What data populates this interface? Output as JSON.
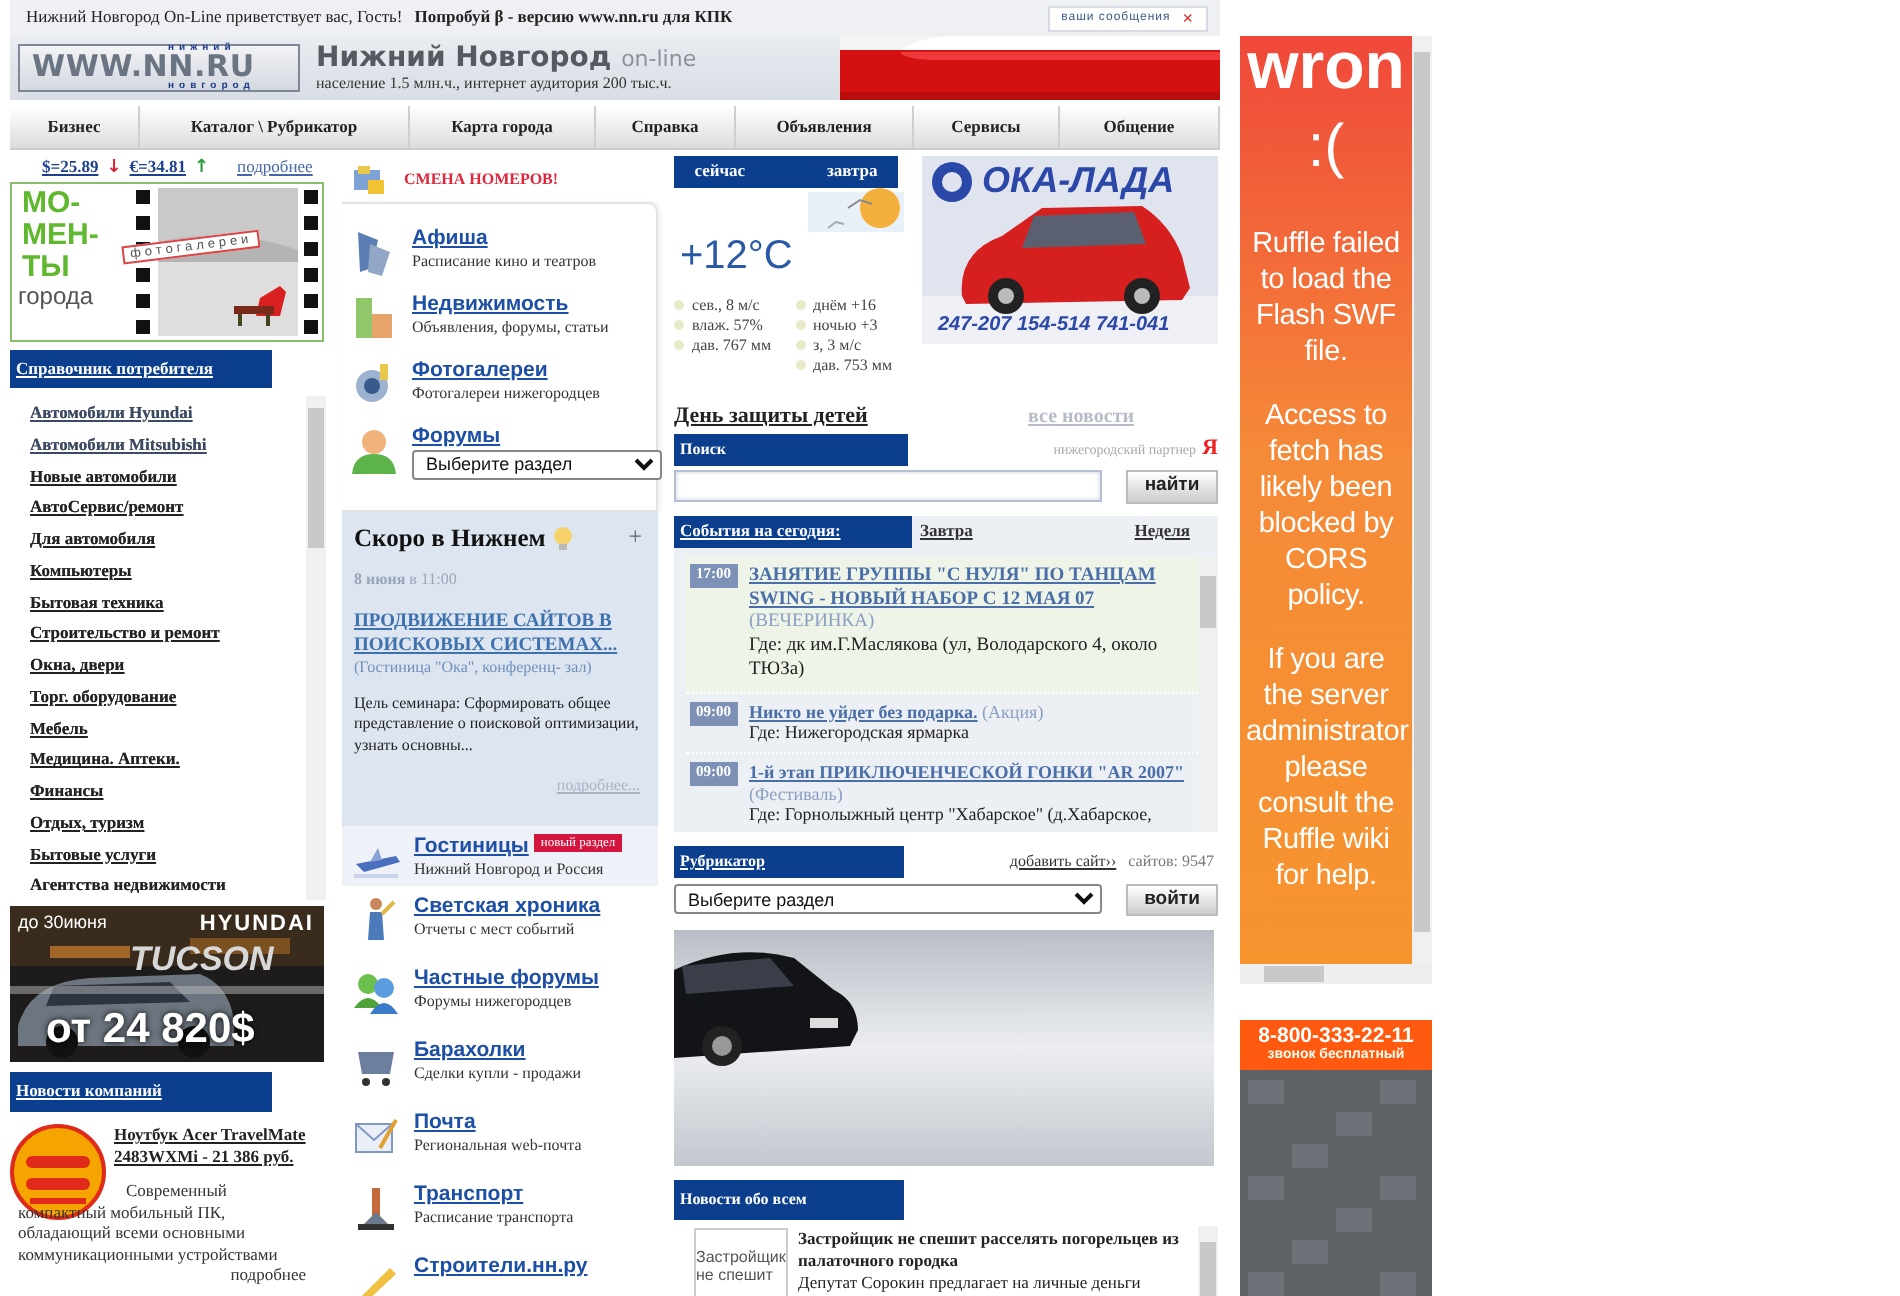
{
  "top_bar": {
    "greeting": "Нижний Новгород On-Line приветствует вас, Гость!",
    "promo": "Попробуй β - версию www.nn.ru для КПК",
    "messages_button": "ваши сообщения",
    "close_button": "×"
  },
  "logo": {
    "main": "WWW.NN.RU",
    "top": "нижний",
    "bottom": "новгород"
  },
  "site": {
    "title": "Нижний Новгород",
    "suffix": "on-line",
    "tagline": "население 1.5 млн.ч., интернет аудитория 200 тыс.ч."
  },
  "nav": [
    "Бизнес",
    "Каталог \\ Рубрикатор",
    "Карта города",
    "Справка",
    "Объявления",
    "Сервисы",
    "Общение"
  ],
  "currency": {
    "rates": [
      {
        "text": "$=25.89",
        "arrow": "↓",
        "kind": "down"
      },
      {
        "text": "€=34.81",
        "arrow": "↑",
        "kind": "up"
      }
    ],
    "more": "подробнее"
  },
  "photo_banner": {
    "title_lines": [
      "МО-",
      "МЕН-",
      "ТЫ"
    ],
    "subtitle": "города",
    "tag": "фотогалереи"
  },
  "consumer_guide": {
    "title": "Справочник потребителя",
    "items": [
      {
        "label": "Автомобили Hyundai",
        "kind": "sponsored"
      },
      {
        "label": "Автомобили Mitsubishi",
        "kind": "sponsored"
      },
      {
        "label": "Новые автомобили",
        "kind": "link"
      },
      {
        "label": "АвтоСервис/ремонт",
        "kind": "link"
      },
      {
        "label": "Для автомобиля",
        "kind": "link"
      },
      {
        "label": "Компьютеры",
        "kind": "link"
      },
      {
        "label": "Бытовая техника",
        "kind": "link"
      },
      {
        "label": "Строительство и ремонт",
        "kind": "link"
      },
      {
        "label": "Окна, двери",
        "kind": "link"
      },
      {
        "label": "Торг. оборудование",
        "kind": "link"
      },
      {
        "label": "Мебель",
        "kind": "link"
      },
      {
        "label": "Медицина. Аптеки.",
        "kind": "link"
      },
      {
        "label": "Финансы",
        "kind": "link"
      },
      {
        "label": "Отдых, туризм",
        "kind": "link"
      },
      {
        "label": "Бытовые услуги",
        "kind": "link"
      },
      {
        "label": "Агентства недвижимости",
        "kind": "plain"
      }
    ]
  },
  "car_ad": {
    "promo": "до 30июня",
    "brand": "HYUNDAI",
    "model": "TUCSON",
    "price": "от 24 820$"
  },
  "company_news": {
    "title": "Новости компаний",
    "items": [
      {
        "title": "Ноутбук Acer TravelMate 2483WXMi - 21 386 руб.",
        "text": "Современный компактный мобильный ПК, обладающий всеми основными коммуникационными устройствами",
        "more": "подробнее"
      }
    ]
  },
  "notice": "СМЕНА НОМЕРОВ!",
  "services": [
    {
      "title": "Афиша",
      "subtitle": "Расписание кино и театров"
    },
    {
      "title": "Недвижимость",
      "subtitle": "Объявления, форумы, статьи"
    },
    {
      "title": "Фотогалереи",
      "subtitle": "Фотогалереи нижегородцев"
    },
    {
      "title": "Форумы",
      "select": "Выберите раздел"
    }
  ],
  "soon": {
    "title": "Скоро в Нижнем",
    "plus": "+",
    "date": "8 июня",
    "time": "в 11:00",
    "headline": "ПРОДВИЖЕНИЕ САЙТОВ В ПОИСКОВЫХ СИСТЕМАХ...",
    "place": "(Гостиница \"Ока\", конференц- зал)",
    "text": "Цель семинара: Сформировать общее представление о поисковой оптимизации, узнать основны...",
    "more": "подробнее..."
  },
  "services_more": [
    {
      "title": "Гостиницы",
      "subtitle": "Нижний Новгород и Россия",
      "badge": "новый раздел",
      "highlighted": true
    },
    {
      "title": "Светская хроника",
      "subtitle": "Отчеты с мест событий",
      "highlighted": false
    },
    {
      "title": "Частные форумы",
      "subtitle": "Форумы нижегородцев",
      "highlighted": false
    },
    {
      "title": "Барахолки",
      "subtitle": "Сделки купли - продажи",
      "highlighted": false
    },
    {
      "title": "Почта",
      "subtitle": "Региональная web-почта",
      "highlighted": false
    },
    {
      "title": "Транспорт",
      "subtitle": "Расписание транспорта",
      "highlighted": false
    },
    {
      "title": "Строители.нн.ру",
      "highlighted": false
    }
  ],
  "weather": {
    "tabs": [
      "сейчас",
      "завтра"
    ],
    "temperature": "+12°C",
    "now": [
      "сев., 8 м/с",
      "влаж. 57%",
      "дав. 767 мм"
    ],
    "tomorrow": [
      "днём +16",
      "ночью +3",
      "з, 3 м/с",
      "дав. 753 мм"
    ]
  },
  "oka_ad": {
    "brand": "ОКА-ЛАДА",
    "phones": "247-207 154-514 741-041"
  },
  "headline": {
    "title": "День защиты детей",
    "all_news": "все новости"
  },
  "search": {
    "title": "Поиск",
    "partner": "нижегородский партнер",
    "partner_logo": "Я",
    "button": "найти"
  },
  "events": {
    "tabs": [
      {
        "label": "События на сегодня:",
        "selected": true
      },
      {
        "label": "Завтра",
        "selected": false
      },
      {
        "label": "Неделя",
        "selected": false
      }
    ],
    "items": [
      {
        "kind": "featured",
        "time": "17:00",
        "title": "ЗАНЯТИЕ ГРУППЫ \"С НУЛЯ\" ПО ТАНЦАМ SWING - НОВЫЙ НАБОР С 12 МАЯ 07",
        "category": "(ВЕЧЕРИНКА)",
        "place": "Где: дк им.Г.Маслякова (ул, Володарского 4, около ТЮЗа)"
      },
      {
        "kind": "regular",
        "time": "09:00",
        "title": "Никто не уйдет без подарка.",
        "category": "(Акция)",
        "place": "Где: Нижегородская ярмарка"
      },
      {
        "kind": "regular",
        "time": "09:00",
        "title": "1-й этап ПРИКЛЮЧЕНЧЕСКОЙ ГОНКИ \"AR 2007\"",
        "category": "(Фестиваль)",
        "place": "Где: Горнолыжный центр \"Хабарское\" (д.Хабарское,"
      }
    ]
  },
  "rubricator": {
    "title": "Рубрикатор",
    "add_site": "добавить сайт››",
    "count": "сайтов: 9547",
    "select": "Выберите раздел",
    "button": "войти"
  },
  "news": {
    "title": "Новости обо всем",
    "items": [
      {
        "image_alt": "Застройщик не спешит",
        "title": "Застройщик не спешит расселять погорельцев из палаточного городка",
        "text": "Депутат Сорокин предлагает на личные деньги"
      }
    ]
  },
  "flash_error": {
    "heading": "wron",
    "face": ":(",
    "paragraphs": [
      "Ruffle failed to load the Flash SWF file.",
      "Access to fetch has likely been blocked by CORS policy.",
      "If you are the server administrator please consult the Ruffle wiki for help."
    ]
  },
  "phone_ad": {
    "phone": "8-800-333-22-11",
    "note": "звонок бесплатный"
  }
}
